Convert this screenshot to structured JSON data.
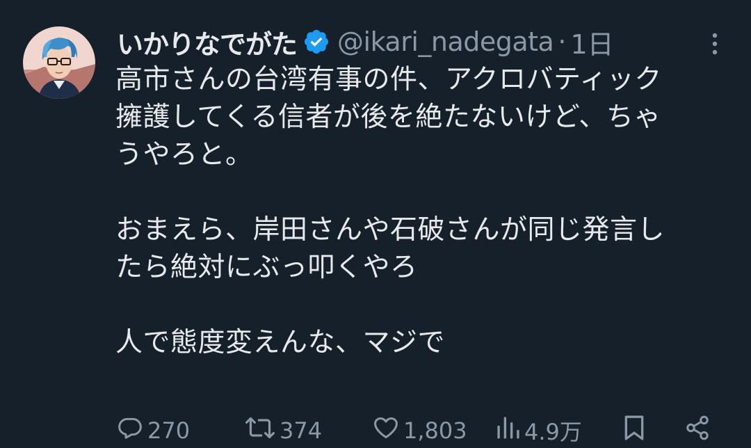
{
  "author": {
    "display_name": "いかりなでがた",
    "handle": "@ikari_nadegata",
    "separator": "·",
    "time": "1日",
    "verified_color": "#1d9bf0"
  },
  "tweet": {
    "lines": [
      "高市さんの台湾有事の件、アクロバティック",
      "擁護してくる信者が後を絶たないけど、ちゃ",
      "うやろと。",
      "",
      "おまえら、岸田さんや石破さんが同じ発言し",
      "たら絶対にぶっ叩くやろ",
      "",
      "人で態度変えんな、マジで"
    ]
  },
  "actions": {
    "replies": "270",
    "retweets": "374",
    "likes": "1,803",
    "views": "4.9万"
  },
  "icons": {
    "verified": "verified-badge-icon",
    "more": "more-vertical-icon",
    "reply": "reply-icon",
    "retweet": "retweet-icon",
    "like": "heart-icon",
    "views": "views-bar-chart-icon",
    "bookmark": "bookmark-icon",
    "share": "share-icon"
  },
  "colors": {
    "background": "#15202b",
    "text": "#e7e9ea",
    "muted": "#8b98a5",
    "accent": "#1d9bf0"
  }
}
